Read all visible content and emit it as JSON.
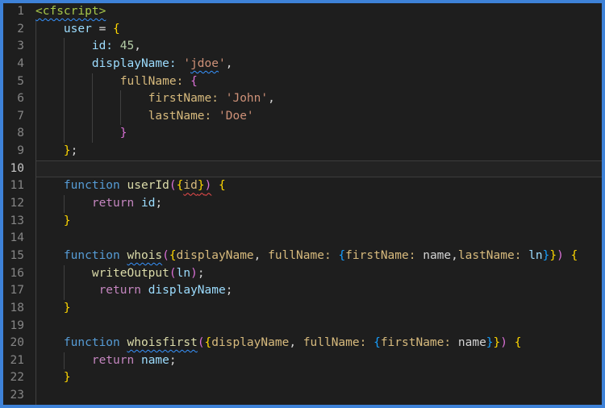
{
  "app": "code-editor",
  "colors": {
    "frame": "#3e82d8",
    "editor_background": "#1e1e1e",
    "current_line_background": "#232323",
    "current_line_border": "#3c3c3c",
    "line_number": "#858585",
    "line_number_active": "#c6c6c6",
    "indent_guide": "#404040",
    "tag": "#a8c84a",
    "keyword": "#569cd6",
    "control_keyword": "#c586c0",
    "function_name": "#dcdcaa",
    "variable": "#9cdcfe",
    "object_key": "#d7ba7d",
    "string": "#ce9178",
    "number": "#b5cea8",
    "punctuation": "#d4d4d4",
    "bracket_gold": "#ffd700",
    "bracket_pink": "#da70d6",
    "bracket_blue": "#179fff",
    "squiggle_info": "#3794ff",
    "squiggle_error": "#f14c4c"
  },
  "editor": {
    "active_line": 10,
    "lines": [
      {
        "n": 1,
        "guides": [],
        "segs": [
          {
            "t": "<cfscript>",
            "c": "tag",
            "sq": "blue"
          }
        ]
      },
      {
        "n": 2,
        "guides": [
          0
        ],
        "segs": [
          {
            "t": "    "
          },
          {
            "t": "user",
            "c": "var"
          },
          {
            "t": " = ",
            "c": "pl"
          },
          {
            "t": "{",
            "c": "b1"
          }
        ]
      },
      {
        "n": 3,
        "guides": [
          0,
          4
        ],
        "segs": [
          {
            "t": "        "
          },
          {
            "t": "id:",
            "c": "var"
          },
          {
            "t": " "
          },
          {
            "t": "45",
            "c": "num"
          },
          {
            "t": ",",
            "c": "pl"
          }
        ]
      },
      {
        "n": 4,
        "guides": [
          0,
          4
        ],
        "segs": [
          {
            "t": "        "
          },
          {
            "t": "displayName:",
            "c": "var"
          },
          {
            "t": " "
          },
          {
            "t": "'",
            "c": "str"
          },
          {
            "t": "jdoe",
            "c": "str",
            "sq": "blue"
          },
          {
            "t": "'",
            "c": "str"
          },
          {
            "t": ",",
            "c": "pl"
          }
        ]
      },
      {
        "n": 5,
        "guides": [
          0,
          4,
          8
        ],
        "segs": [
          {
            "t": "            "
          },
          {
            "t": "fullName:",
            "c": "key"
          },
          {
            "t": " "
          },
          {
            "t": "{",
            "c": "b2"
          }
        ]
      },
      {
        "n": 6,
        "guides": [
          0,
          4,
          8,
          12
        ],
        "segs": [
          {
            "t": "                "
          },
          {
            "t": "firstName:",
            "c": "key"
          },
          {
            "t": " "
          },
          {
            "t": "'John'",
            "c": "str"
          },
          {
            "t": ",",
            "c": "pl"
          }
        ]
      },
      {
        "n": 7,
        "guides": [
          0,
          4,
          8,
          12
        ],
        "segs": [
          {
            "t": "                "
          },
          {
            "t": "lastName:",
            "c": "key"
          },
          {
            "t": " "
          },
          {
            "t": "'Doe'",
            "c": "str"
          }
        ]
      },
      {
        "n": 8,
        "guides": [
          0,
          4,
          8
        ],
        "segs": [
          {
            "t": "            "
          },
          {
            "t": "}",
            "c": "b2"
          }
        ]
      },
      {
        "n": 9,
        "guides": [
          0
        ],
        "segs": [
          {
            "t": "    "
          },
          {
            "t": "}",
            "c": "b1"
          },
          {
            "t": ";",
            "c": "pl"
          }
        ]
      },
      {
        "n": 10,
        "guides": [
          0
        ],
        "segs": []
      },
      {
        "n": 11,
        "guides": [
          0
        ],
        "segs": [
          {
            "t": "    "
          },
          {
            "t": "function",
            "c": "kw"
          },
          {
            "t": " "
          },
          {
            "t": "userId",
            "c": "fn"
          },
          {
            "t": "(",
            "c": "b2"
          },
          {
            "t": "{",
            "c": "b1"
          },
          {
            "t": "id",
            "c": "key",
            "sq": "red"
          },
          {
            "t": "}",
            "c": "b1",
            "sq": "red"
          },
          {
            "t": ")",
            "c": "b2",
            "sq": "red"
          },
          {
            "t": " "
          },
          {
            "t": "{",
            "c": "b1"
          }
        ]
      },
      {
        "n": 12,
        "guides": [
          0,
          4
        ],
        "segs": [
          {
            "t": "        "
          },
          {
            "t": "return",
            "c": "ctrl"
          },
          {
            "t": " "
          },
          {
            "t": "id",
            "c": "var"
          },
          {
            "t": ";",
            "c": "pl"
          }
        ]
      },
      {
        "n": 13,
        "guides": [
          0
        ],
        "segs": [
          {
            "t": "    "
          },
          {
            "t": "}",
            "c": "b1"
          }
        ]
      },
      {
        "n": 14,
        "guides": [
          0
        ],
        "segs": []
      },
      {
        "n": 15,
        "guides": [
          0
        ],
        "segs": [
          {
            "t": "    "
          },
          {
            "t": "function",
            "c": "kw"
          },
          {
            "t": " "
          },
          {
            "t": "whois",
            "c": "fn",
            "sq": "blue"
          },
          {
            "t": "(",
            "c": "b2"
          },
          {
            "t": "{",
            "c": "b1"
          },
          {
            "t": "displayName",
            "c": "key"
          },
          {
            "t": ", ",
            "c": "pl"
          },
          {
            "t": "fullName:",
            "c": "key"
          },
          {
            "t": " "
          },
          {
            "t": "{",
            "c": "b3"
          },
          {
            "t": "firstName:",
            "c": "key"
          },
          {
            "t": " "
          },
          {
            "t": "name",
            "c": "pl"
          },
          {
            "t": ",",
            "c": "pl"
          },
          {
            "t": "lastName:",
            "c": "key"
          },
          {
            "t": " "
          },
          {
            "t": "ln",
            "c": "var"
          },
          {
            "t": "}",
            "c": "b3"
          },
          {
            "t": "}",
            "c": "b1"
          },
          {
            "t": ")",
            "c": "b2"
          },
          {
            "t": " "
          },
          {
            "t": "{",
            "c": "b1"
          }
        ]
      },
      {
        "n": 16,
        "guides": [
          0,
          4
        ],
        "segs": [
          {
            "t": "        "
          },
          {
            "t": "writeOutput",
            "c": "fn"
          },
          {
            "t": "(",
            "c": "b2"
          },
          {
            "t": "ln",
            "c": "var"
          },
          {
            "t": ")",
            "c": "b2"
          },
          {
            "t": ";",
            "c": "pl"
          }
        ]
      },
      {
        "n": 17,
        "guides": [
          0,
          4
        ],
        "segs": [
          {
            "t": "         "
          },
          {
            "t": "return",
            "c": "ctrl"
          },
          {
            "t": " "
          },
          {
            "t": "displayName",
            "c": "var"
          },
          {
            "t": ";",
            "c": "pl"
          }
        ]
      },
      {
        "n": 18,
        "guides": [
          0
        ],
        "segs": [
          {
            "t": "    "
          },
          {
            "t": "}",
            "c": "b1"
          }
        ]
      },
      {
        "n": 19,
        "guides": [
          0
        ],
        "segs": []
      },
      {
        "n": 20,
        "guides": [
          0
        ],
        "segs": [
          {
            "t": "    "
          },
          {
            "t": "function",
            "c": "kw"
          },
          {
            "t": " "
          },
          {
            "t": "whoisfirst",
            "c": "fn",
            "sq": "blue"
          },
          {
            "t": "(",
            "c": "b2"
          },
          {
            "t": "{",
            "c": "b1"
          },
          {
            "t": "displayName",
            "c": "key"
          },
          {
            "t": ", ",
            "c": "pl"
          },
          {
            "t": "fullName:",
            "c": "key"
          },
          {
            "t": " "
          },
          {
            "t": "{",
            "c": "b3"
          },
          {
            "t": "firstName:",
            "c": "key"
          },
          {
            "t": " "
          },
          {
            "t": "name",
            "c": "pl"
          },
          {
            "t": "}",
            "c": "b3"
          },
          {
            "t": "}",
            "c": "b1"
          },
          {
            "t": ")",
            "c": "b2"
          },
          {
            "t": " "
          },
          {
            "t": "{",
            "c": "b1"
          }
        ]
      },
      {
        "n": 21,
        "guides": [
          0,
          4
        ],
        "segs": [
          {
            "t": "        "
          },
          {
            "t": "return",
            "c": "ctrl"
          },
          {
            "t": " "
          },
          {
            "t": "name",
            "c": "var"
          },
          {
            "t": ";",
            "c": "pl"
          }
        ]
      },
      {
        "n": 22,
        "guides": [
          0
        ],
        "segs": [
          {
            "t": "    "
          },
          {
            "t": "}",
            "c": "b1"
          }
        ]
      },
      {
        "n": 23,
        "guides": [
          0
        ],
        "segs": []
      }
    ]
  }
}
